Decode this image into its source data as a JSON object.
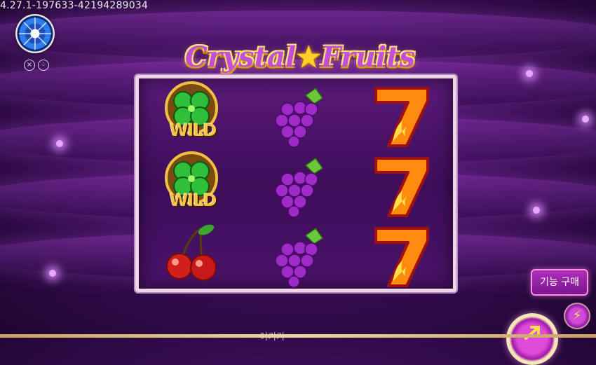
{
  "build_id": "4.27.1-197633-42194289034",
  "game_title": {
    "part1": "Crystal",
    "part2": "Fruits"
  },
  "reels": [
    [
      "wild-clover",
      "wild-clover",
      "cherries"
    ],
    [
      "grapes",
      "grapes",
      "grapes"
    ],
    [
      "seven",
      "seven",
      "seven"
    ]
  ],
  "wild_label": "WILD",
  "buy_feature_label": "기능 구매",
  "bottom_text": "이기기",
  "colors": {
    "background": "#3a0d55",
    "reel_frame": "#f0d4e8",
    "title_fill": "#c24fd8",
    "title_outline": "#ffe27a",
    "button_accent": "#b02fb8"
  },
  "icons": {
    "menu_wheel": "wheel-icon",
    "close": "close-icon",
    "menu": "dots-menu-icon",
    "turbo": "lightning-icon",
    "spin": "spin-arrow-icon"
  }
}
